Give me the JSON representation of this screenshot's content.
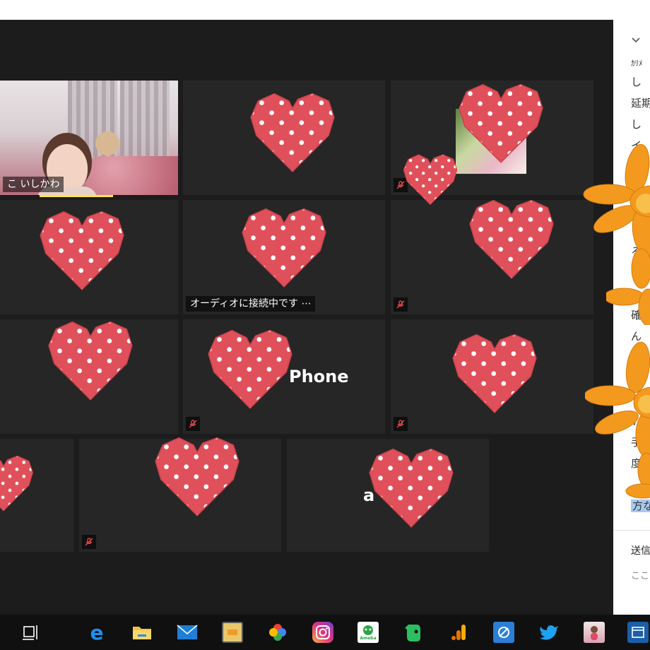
{
  "participants": {
    "host_name": "こ いしかわ",
    "connecting_status": "オーディオに接続中です ⋯",
    "center_name": "Phone",
    "center_name_partial": "a"
  },
  "chat_panel": {
    "top_small": "ｶﾘﾒ",
    "lines": [
      "し",
      "延期",
      "し",
      "イ",
      "る",
      "確",
      "ん",
      "ｶ",
      "手",
      "度"
    ],
    "highlight_line": "方な",
    "send_label": "送信",
    "input_placeholder": "ここに"
  },
  "taskbar": {
    "icons": [
      "task-view-icon",
      "edge-icon",
      "file-explorer-icon",
      "mail-icon",
      "sticky-notes-icon",
      "google-photos-icon",
      "instagram-icon",
      "ameba-icon",
      "evernote-icon",
      "analytics-icon",
      "sync-icon",
      "twitter-icon",
      "profile-photo-icon",
      "window-icon"
    ],
    "ameba_label": "Ameba"
  },
  "colors": {
    "meeting_bg": "#1c1c1c",
    "tile_bg": "#262626",
    "heart": "#e0505a",
    "speaker_highlight": "#ffe54f",
    "flower": "#f39a1e",
    "taskbar_bg": "#101010"
  }
}
